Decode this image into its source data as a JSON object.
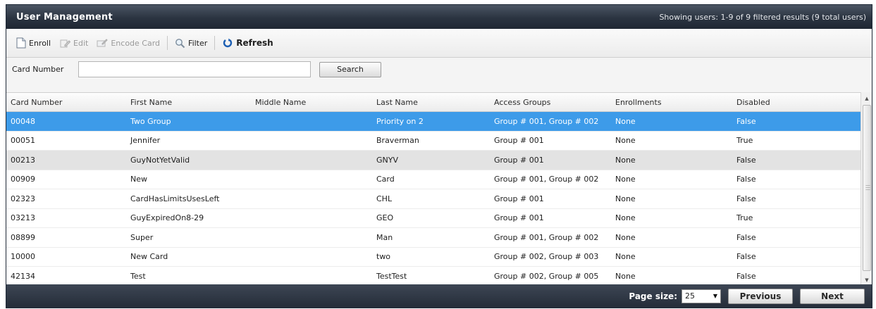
{
  "header": {
    "title": "User Management",
    "status": "Showing users: 1-9 of 9 filtered results (9 total users)"
  },
  "toolbar": {
    "enroll": "Enroll",
    "edit": "Edit",
    "encode_card": "Encode Card",
    "filter": "Filter",
    "refresh": "Refresh"
  },
  "search": {
    "label": "Card Number",
    "value": "",
    "placeholder": "",
    "button": "Search"
  },
  "grid": {
    "columns": [
      "Card Number",
      "First Name",
      "Middle Name",
      "Last Name",
      "Access Groups",
      "Enrollments",
      "Disabled"
    ],
    "rows": [
      [
        "00048",
        "Two Group",
        "",
        "Priority on 2",
        "Group # 001, Group # 002",
        "None",
        "False"
      ],
      [
        "00051",
        "Jennifer",
        "",
        "Braverman",
        "Group # 001",
        "None",
        "True"
      ],
      [
        "00213",
        "GuyNotYetValid",
        "",
        "GNYV",
        "Group # 001",
        "None",
        "False"
      ],
      [
        "00909",
        "New",
        "",
        "Card",
        "Group # 001, Group # 002",
        "None",
        "False"
      ],
      [
        "02323",
        "CardHasLimitsUsesLeft",
        "",
        "CHL",
        "Group # 001",
        "None",
        "False"
      ],
      [
        "03213",
        "GuyExpiredOn8-29",
        "",
        "GEO",
        "Group # 001",
        "None",
        "True"
      ],
      [
        "08899",
        "Super",
        "",
        "Man",
        "Group # 001, Group # 002",
        "None",
        "False"
      ],
      [
        "10000",
        "New Card",
        "",
        "two",
        "Group # 002, Group # 003",
        "None",
        "False"
      ],
      [
        "42134",
        "Test",
        "",
        "TestTest",
        "Group # 002, Group # 005",
        "None",
        "False"
      ]
    ],
    "selected_row": 0,
    "hover_row": 2
  },
  "footer": {
    "page_size_label": "Page size:",
    "page_size_value": "25",
    "previous": "Previous",
    "next": "Next"
  },
  "colors": {
    "selected_row": "#3d9be9",
    "header_bar": "#2b3441"
  }
}
